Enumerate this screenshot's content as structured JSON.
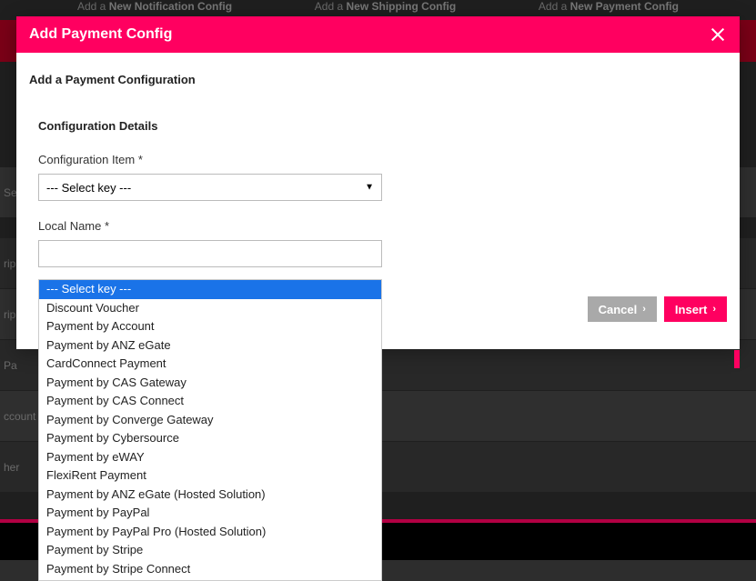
{
  "background": {
    "topLinks": {
      "notif_pre": "Add a ",
      "notif_bold": "New Notification Config",
      "ship_pre": "Add a ",
      "ship_bold": "New Shipping Config",
      "pay_pre": "Add a ",
      "pay_bold": "New Payment Config"
    },
    "side_labels": [
      "Se",
      "rip",
      "rip",
      "Pa",
      "ccount",
      "her"
    ]
  },
  "modal": {
    "title": "Add Payment Config",
    "subtitle": "Add a Payment Configuration",
    "section": "Configuration Details",
    "field_config_label": "Configuration Item *",
    "field_config_value": "--- Select key ---",
    "field_name_label": "Local Name *",
    "field_name_value": "",
    "buttons": {
      "cancel": "Cancel",
      "insert": "Insert"
    }
  },
  "dropdown": {
    "selected_index": 0,
    "options": [
      "--- Select key ---",
      "Discount Voucher",
      "Payment by Account",
      "Payment by ANZ eGate",
      "CardConnect Payment",
      "Payment by CAS Gateway",
      "Payment by CAS Connect",
      "Payment by Converge Gateway",
      "Payment by Cybersource",
      "Payment by eWAY",
      "FlexiRent Payment",
      "Payment by ANZ eGate (Hosted Solution)",
      "Payment by PayPal",
      "Payment by PayPal Pro (Hosted Solution)",
      "Payment by Stripe",
      "Payment by Stripe Connect"
    ]
  }
}
